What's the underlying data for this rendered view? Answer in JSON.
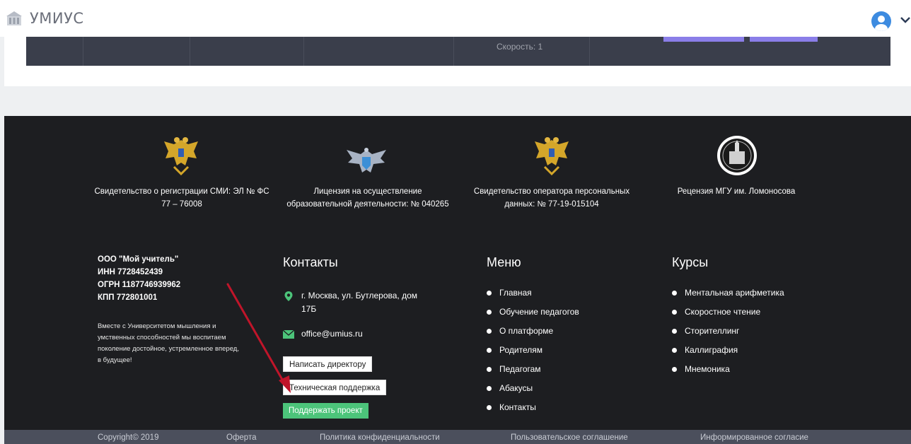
{
  "app": {
    "name": "УМИУС"
  },
  "table": {
    "speed": "Скорость: 1"
  },
  "certificates": [
    {
      "icon": "double-headed-eagle-emblem",
      "text": "Свидетельство о регистрации СМИ: ЭЛ № ФС 77 – 76008"
    },
    {
      "icon": "eagle-shield-emblem",
      "text": "Лицензия на осуществление образовательной деятельности: № 040265"
    },
    {
      "icon": "double-headed-eagle-emblem",
      "text": "Свидетельство оператора персональных данных: № 77-19-015104"
    },
    {
      "icon": "msu-seal",
      "text": "Рецензия МГУ им. Ломоносова"
    }
  ],
  "company": {
    "name": "ООО \"Мой учитель\"",
    "inn": "ИНН 7728452439",
    "ogrn": "ОГРН 1187746939962",
    "kpp": "КПП 772801001",
    "tagline": "Вместе с Университетом мышления и умственных способностей мы воспитаем поколение достойное, устремленное вперед, в будущее!"
  },
  "contacts": {
    "title": "Контакты",
    "address": "г. Москва, ул. Бутлерова, дом 17Б",
    "email": "office@umius.ru",
    "write_director": "Написать директору",
    "tech_support": "Техническая поддержка",
    "support_project": "Поддержать проект"
  },
  "menu": {
    "title": "Меню",
    "items": [
      "Главная",
      "Обучение педагогов",
      "О платформе",
      "Родителям",
      "Педагогам",
      "Абакусы",
      "Контакты"
    ]
  },
  "courses": {
    "title": "Курсы",
    "items": [
      "Ментальная арифметика",
      "Скоростное чтение",
      "Сторителлинг",
      "Каллиграфия",
      "Мнемоника"
    ]
  },
  "footer_bar": {
    "copyright": "Copyright© 2019",
    "offer": "Оферта",
    "privacy": "Политика конфиденциальности",
    "agreement": "Пользовательское соглашение",
    "consent": "Информированное согласие"
  },
  "colors": {
    "footer_bg": "#1d1e21",
    "accent_green": "#4cc47a",
    "annotation_arrow": "#c0152a",
    "avatar_blue": "#3d8be0"
  }
}
